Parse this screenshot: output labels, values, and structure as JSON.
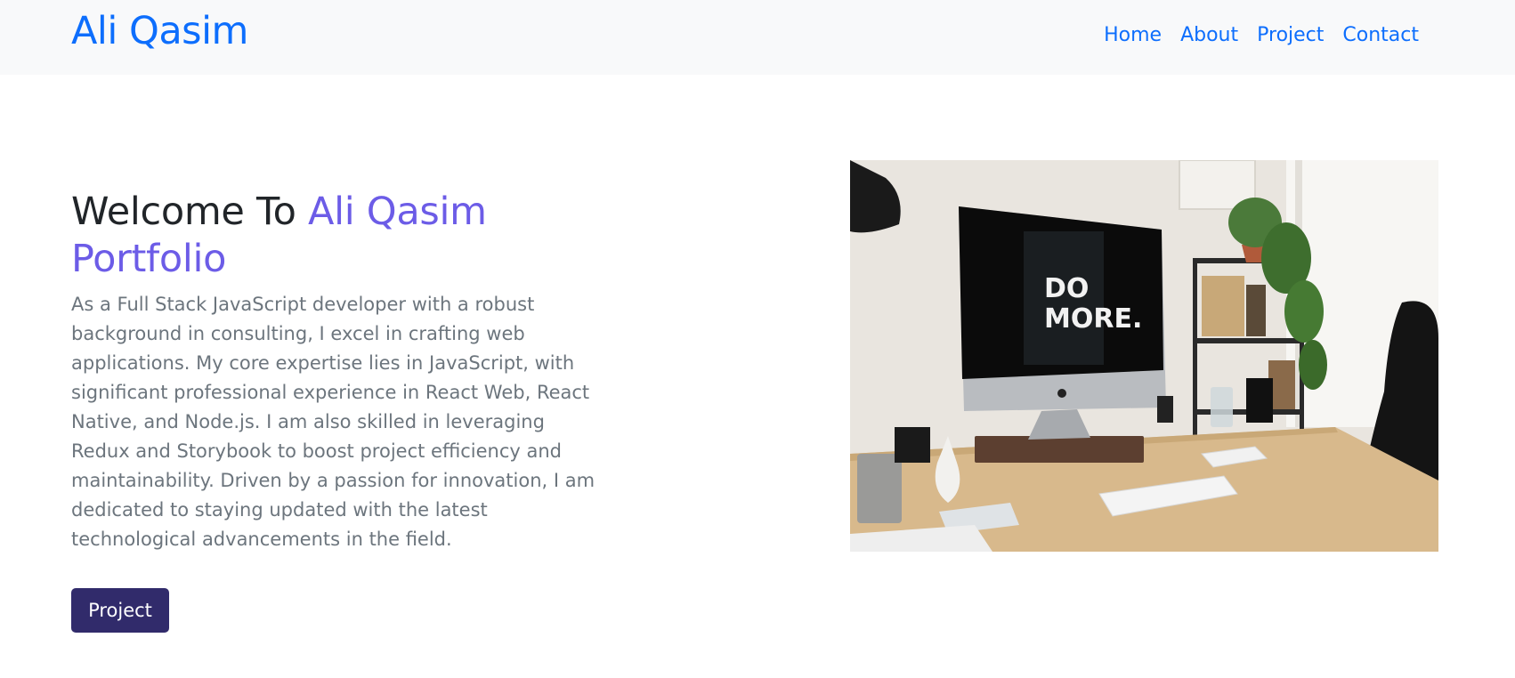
{
  "navbar": {
    "brand": "Ali Qasim",
    "links": [
      {
        "label": "Home"
      },
      {
        "label": "About"
      },
      {
        "label": "Project"
      },
      {
        "label": "Contact"
      }
    ]
  },
  "hero": {
    "title_prefix": "Welcome To ",
    "title_accent": "Ali Qasim Portfolio",
    "description": "As a Full Stack JavaScript developer with a robust background in consulting, I excel in crafting web applications. My core expertise lies in JavaScript, with significant professional experience in React Web, React Native, and Node.js. I am also skilled in leveraging Redux and Storybook to boost project efficiency and maintainability. Driven by a passion for innovation, I am dedicated to staying updated with the latest technological advancements in the field.",
    "button_label": "Project",
    "image": {
      "screen_text_line1": "DO",
      "screen_text_line2": "MORE."
    }
  },
  "colors": {
    "brand": "#0d6efd",
    "accent": "#6c5ce7",
    "button": "#312b6b",
    "navbar_bg": "#f8f9fa"
  }
}
